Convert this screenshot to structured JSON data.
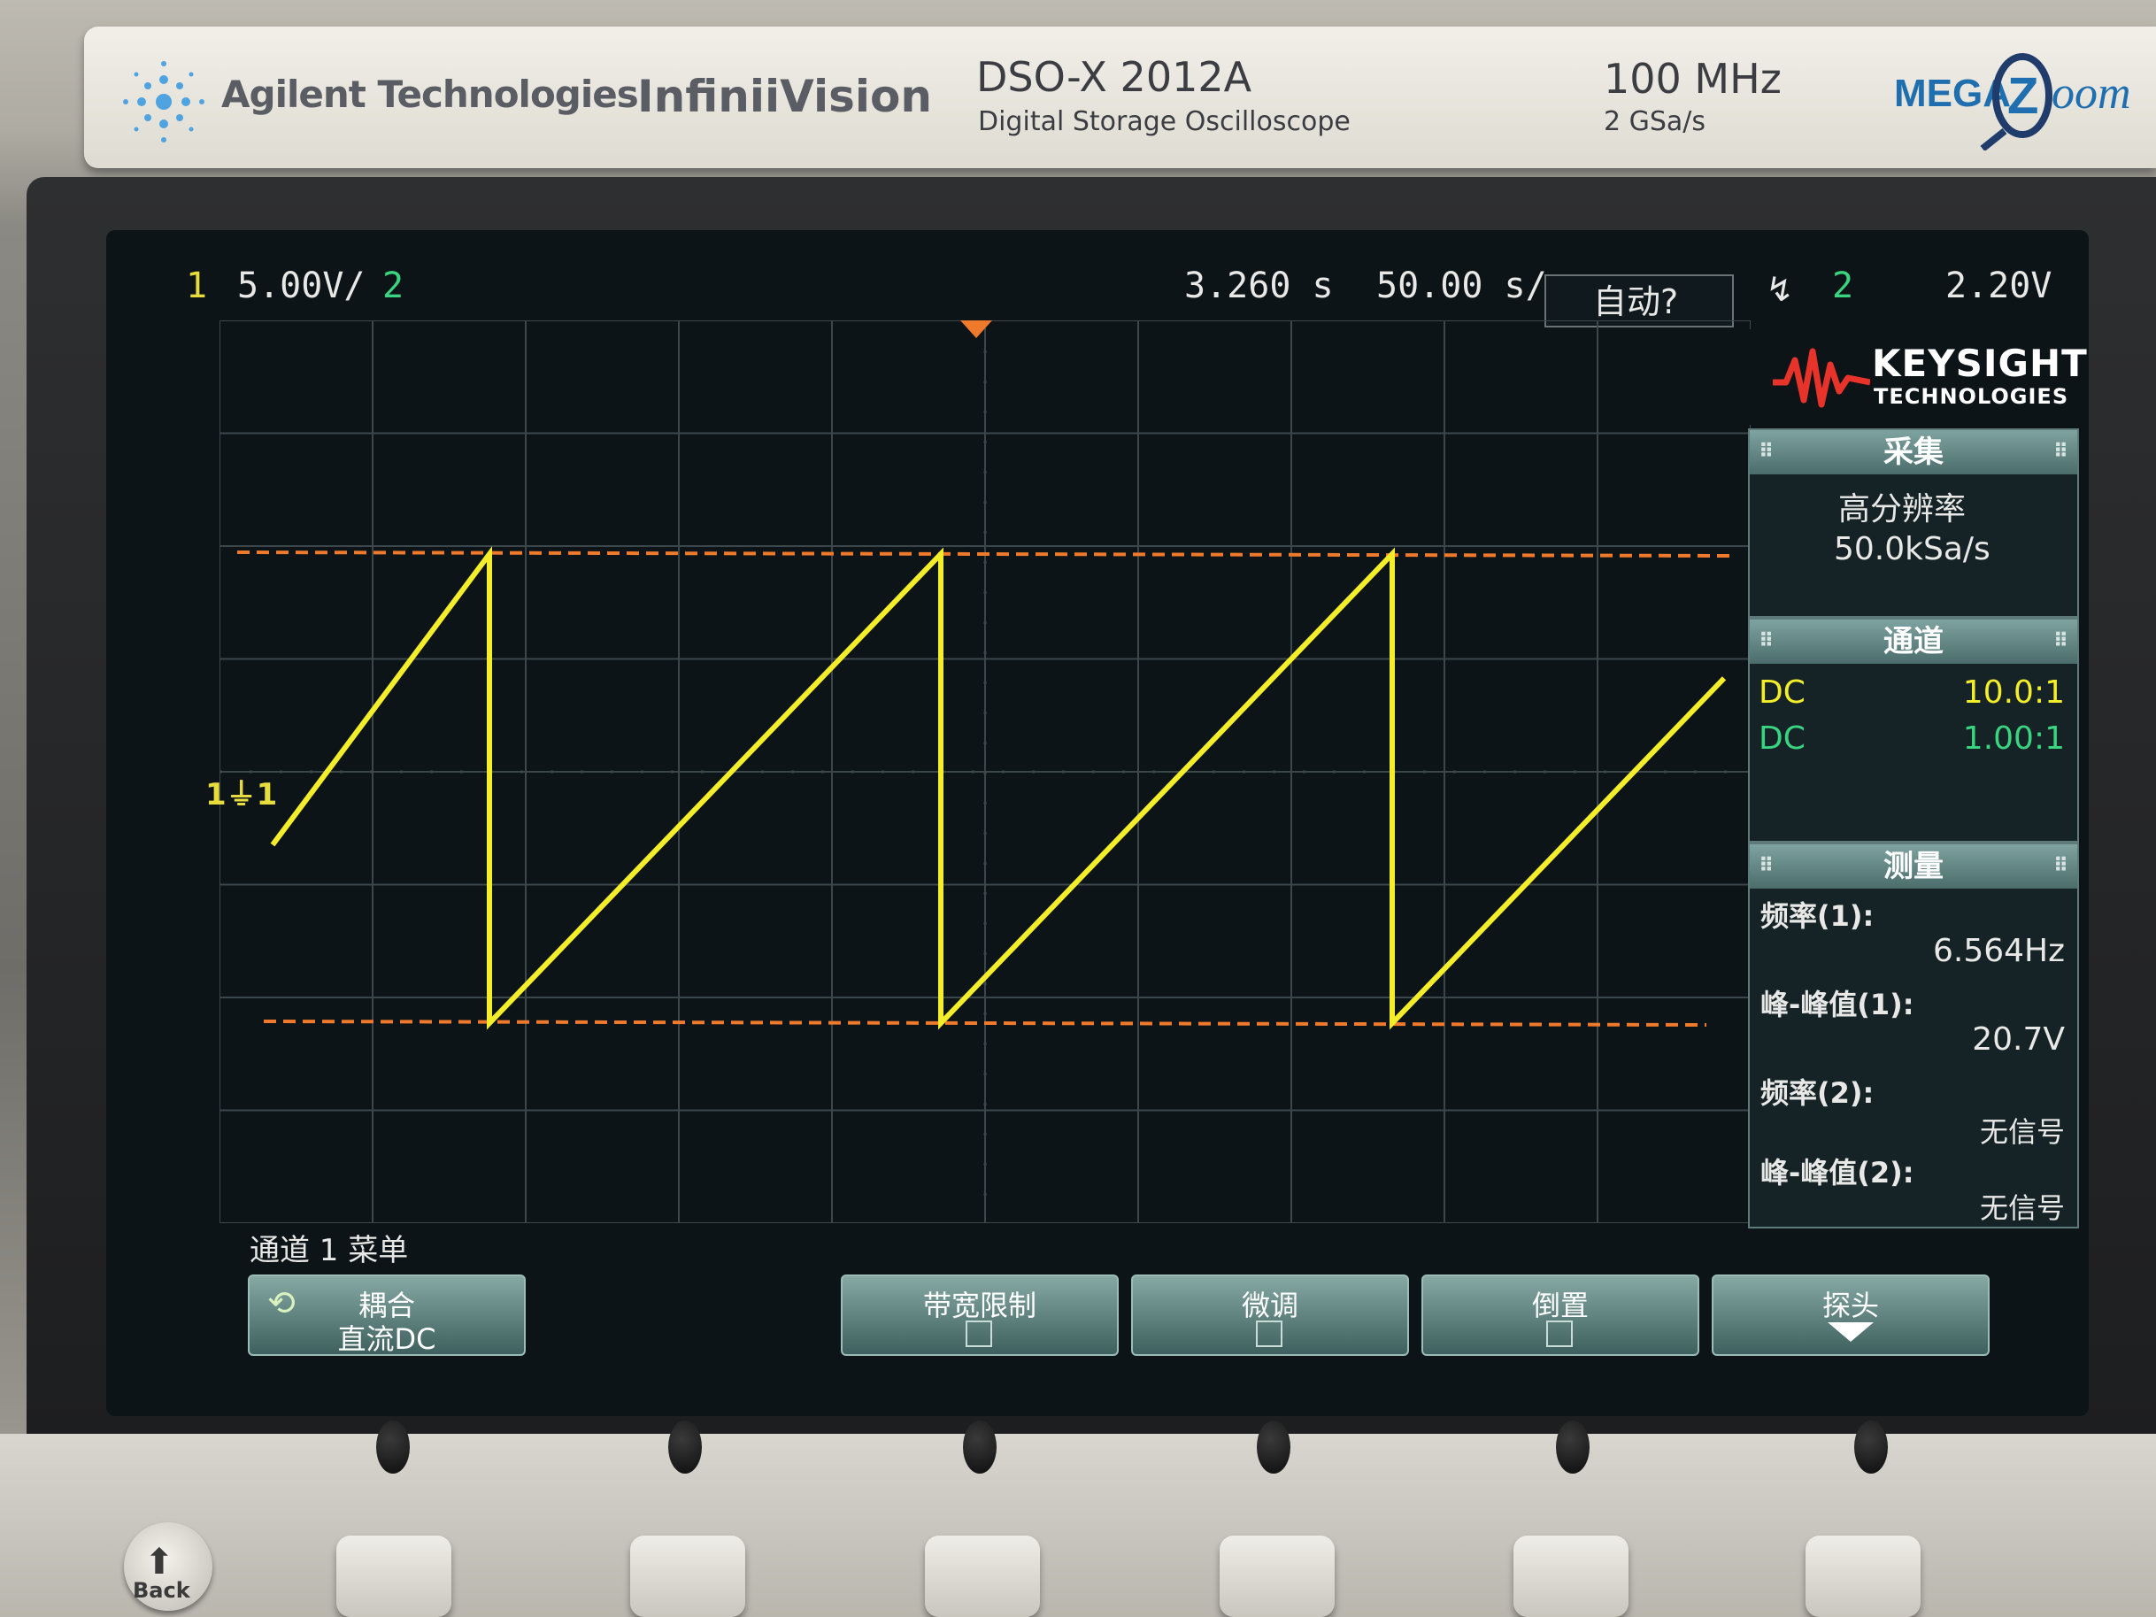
{
  "header": {
    "brand": "Agilent Technologies",
    "series": "InfiniiVision",
    "model": "DSO-X 2012A",
    "model_desc": "Digital Storage Oscilloscope",
    "bandwidth": "100 MHz",
    "sample_rate": "2 GSa/s",
    "zoom_logo": "MEGA Zoom"
  },
  "status_bar": {
    "ch1_num": "1",
    "ch1_scale": "5.00V/",
    "ch2_num": "2",
    "delay": "3.260 s",
    "timebase": "50.00 s/",
    "mode": "自动?",
    "trigger_icon": "↯",
    "trigger_source": "2",
    "trigger_level": "2.20V"
  },
  "markers": {
    "ch1": "1⏚1"
  },
  "side_panel": {
    "logo_name": "KEYSIGHT",
    "logo_sub": "TECHNOLOGIES",
    "acquire": {
      "title": "采集",
      "mode": "高分辨率",
      "rate": "50.0kSa/s"
    },
    "channels": {
      "title": "通道",
      "rows": [
        {
          "coupling": "DC",
          "probe": "10.0:1"
        },
        {
          "coupling": "DC",
          "probe": "1.00:1"
        }
      ]
    },
    "measure": {
      "title": "测量",
      "items": [
        {
          "label": "频率(1):",
          "value": "6.564Hz"
        },
        {
          "label": "峰-峰值(1):",
          "value": "20.7V"
        },
        {
          "label": "频率(2):",
          "value": "无信号"
        },
        {
          "label": "峰-峰值(2):",
          "value": "无信号"
        }
      ]
    }
  },
  "softkeys": {
    "menu_title": "通道 1 菜单",
    "coupling_label": "耦合",
    "coupling_value": "直流DC",
    "bw_limit": "带宽限制",
    "fine": "微调",
    "invert": "倒置",
    "probe": "探头"
  },
  "front_panel": {
    "back_label": "Back"
  },
  "waveform": {
    "ch1_color": "#f4ee2a",
    "cursor_color": "#f07a2c",
    "grid_color": "#3c474b",
    "frequency_hz": 6.564,
    "peak_to_peak_v": 20.7
  }
}
